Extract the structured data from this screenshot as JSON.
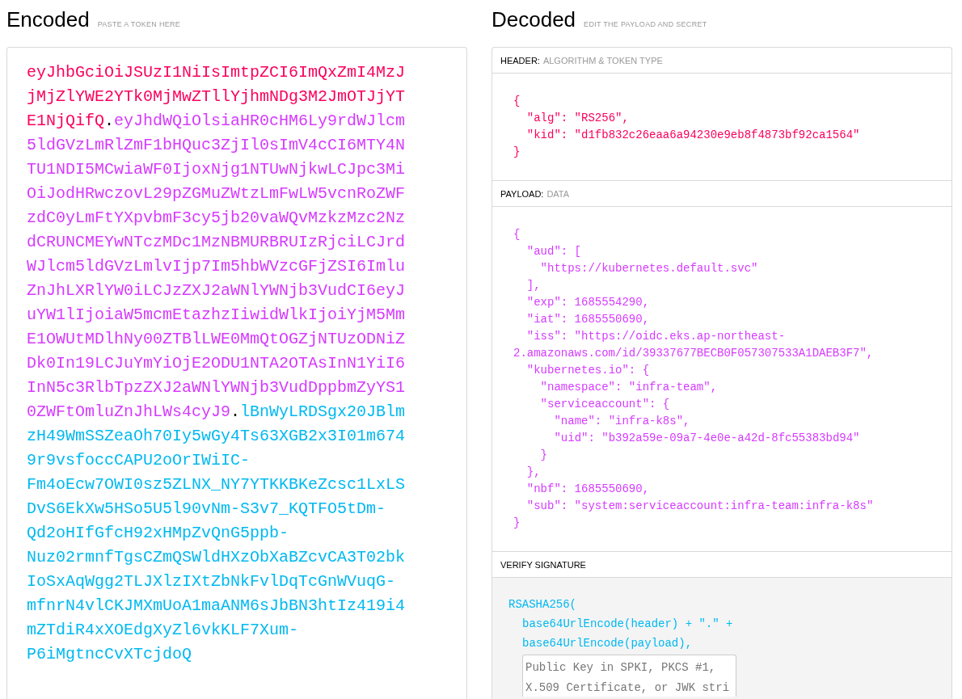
{
  "encoded": {
    "title": "Encoded",
    "subtitle": "PASTE A TOKEN HERE",
    "token": [
      {
        "kind": "header",
        "text": "eyJhbGciOiJSUzI1NiIsImtpZCI6ImQxZmI4MzJjMjZlYWE2YTk0MjMwZTllYjhmNDg3M2JmOTJjYTE1NjQifQ"
      },
      {
        "kind": "separator",
        "text": "."
      },
      {
        "kind": "payload",
        "text": "eyJhdWQiOlsiaHR0cHM6Ly9rdWJlcm5ldGVzLmRlZmF1bHQuc3ZjIl0sImV4cCI6MTY4NTU1NDI5MCwiaWF0IjoxNjg1NTUwNjkwLCJpc3MiOiJodHRwczovL29pZGMuZWtzLmFwLW5vcnRoZWFzdC0yLmFtYXpvbmF3cy5jb20vaWQvMzkzMzc2NzdCRUNCMEYwNTczMDc1MzNBMURBRUIzRjciLCJrdWJlcm5ldGVzLmlvIjp7Im5hbWVzcGFjZSI6ImluZnJhLXRlYW0iLCJzZXJ2aWNlYWNjb3VudCI6eyJuYW1lIjoiaW5mcmEtazhzIiwidWlkIjoiYjM5MmE1OWUtMDlhNy00ZTBlLWE0MmQtOGZjNTUzODNiZDk0In19LCJuYmYiOjE2ODU1NTA2OTAsInN1YiI6InN5c3RlbTpzZXJ2aWNlYWNjb3VudDppbmZyYS10ZWFtOmluZnJhLWs4cyJ9"
      },
      {
        "kind": "separator",
        "text": "."
      },
      {
        "kind": "signature",
        "text": "lBnWyLRDSgx20JBlmzH49WmSSZeaOh70Iy5wGy4Ts63XGB2x3I01m6749r9vsfoccCAPU2oOrIWiIC-Fm4oEcw7OWI0sz5ZLNX_NY7YTKKBKeZcsc1LxLSDvS6EkXw5HSo5U5l90vNm-S3v7_KQTFO5tDm-Qd2oHIfGfcH92xHMpZvQnG5ppb-Nuz02rmnfTgsCZmQSWldHXzObXaBZcvCA3T02bkIoSxAqWgg2TLJXlzIXtZbNkFvlDqTcGnWVuqG-mfnrN4vlCKJMXmUoA1maANM6sJbBN3htIz419i4mZTdiR4xXOEdgXyZl6vkKLF7Xum-P6iMgtncCvXTcjdoQ"
      }
    ]
  },
  "decoded": {
    "title": "Decoded",
    "subtitle": "EDIT THE PAYLOAD AND SECRET",
    "header": {
      "label": "HEADER:",
      "hint": "ALGORITHM & TOKEN TYPE",
      "code": "{\n  \"alg\": \"RS256\",\n  \"kid\": \"d1fb832c26eaa6a94230e9eb8f4873bf92ca1564\"\n}"
    },
    "payload": {
      "label": "PAYLOAD:",
      "hint": "DATA",
      "code": "{\n  \"aud\": [\n    \"https://kubernetes.default.svc\"\n  ],\n  \"exp\": 1685554290,\n  \"iat\": 1685550690,\n  \"iss\": \"https://oidc.eks.ap-northeast-2.amazonaws.com/id/39337677BECB0F057307533A1DAEB3F7\",\n  \"kubernetes.io\": {\n    \"namespace\": \"infra-team\",\n    \"serviceaccount\": {\n      \"name\": \"infra-k8s\",\n      \"uid\": \"b392a59e-09a7-4e0e-a42d-8fc55383bd94\"\n    }\n  },\n  \"nbf\": 1685550690,\n  \"sub\": \"system:serviceaccount:infra-team:infra-k8s\"\n}"
    },
    "verify": {
      "label": "VERIFY SIGNATURE",
      "lines": [
        {
          "kind": "call",
          "text": "RSASHA256("
        },
        {
          "kind": "arg",
          "text": "base64UrlEncode(header) + \".\" +"
        },
        {
          "kind": "arg",
          "text": "base64UrlEncode(payload),"
        }
      ],
      "key_field": {
        "placeholder": "Public Key in SPKI, PKCS #1, X.509 Certificate, or JWK stri"
      }
    }
  }
}
